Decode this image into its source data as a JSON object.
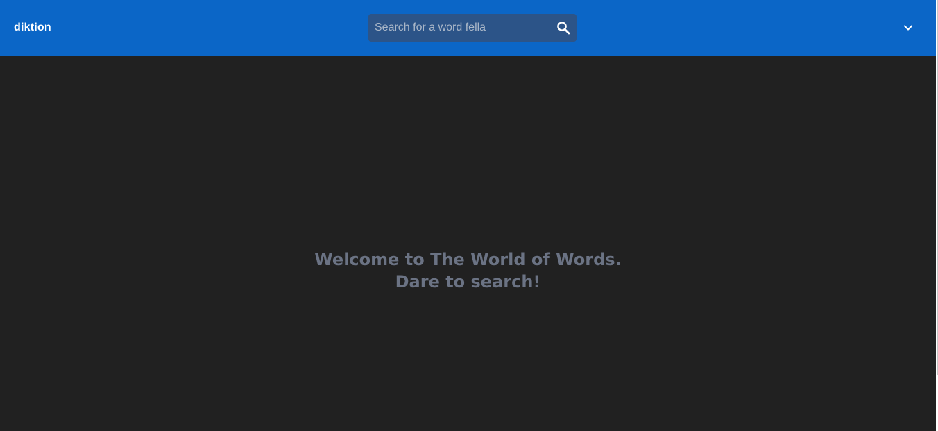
{
  "header": {
    "brand": "diktion",
    "search": {
      "placeholder": "Search for a word fella",
      "value": "",
      "icon": "search-icon"
    },
    "menu_icon": "chevron-down-icon"
  },
  "main": {
    "welcome_line1": "Welcome to The World of Words.",
    "welcome_line2": "Dare to search!"
  },
  "colors": {
    "header_bg": "#0b66c7",
    "search_bg": "#2c5488",
    "page_bg": "#212121",
    "welcome_text": "#6b7384"
  }
}
